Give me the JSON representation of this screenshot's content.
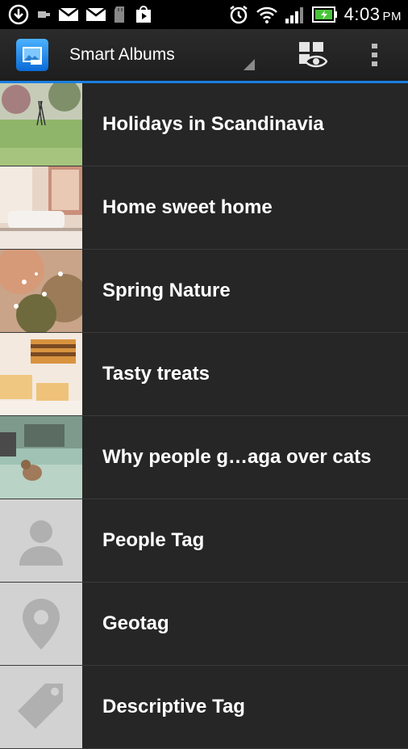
{
  "status_bar": {
    "time": "4:03",
    "ampm": "PM",
    "icons_left": [
      "download-icon",
      "voicemail-icon",
      "gmail-icon",
      "gmail-icon",
      "sd-card-icon",
      "play-store-icon"
    ],
    "icons_right": [
      "alarm-icon",
      "wifi-icon",
      "signal-icon",
      "battery-charging-icon"
    ]
  },
  "action_bar": {
    "title": "Smart Albums",
    "app_icon": "gallery-app-icon",
    "view_button_icon": "view-mode-icon",
    "overflow_icon": "overflow-menu-icon"
  },
  "albums": [
    {
      "label": "Holidays in Scandinavia",
      "thumb": "photo"
    },
    {
      "label": "Home sweet home",
      "thumb": "photo"
    },
    {
      "label": "Spring Nature",
      "thumb": "photo"
    },
    {
      "label": "Tasty treats",
      "thumb": "photo"
    },
    {
      "label": "Why people g…aga over cats",
      "thumb": "photo"
    },
    {
      "label": "People Tag",
      "thumb": "person-icon"
    },
    {
      "label": "Geotag",
      "thumb": "location-pin-icon"
    },
    {
      "label": "Descriptive Tag",
      "thumb": "tag-icon"
    }
  ],
  "colors": {
    "accent": "#1a7fe0",
    "background": "#262626",
    "placeholder_thumb": "#d2d2d2"
  }
}
